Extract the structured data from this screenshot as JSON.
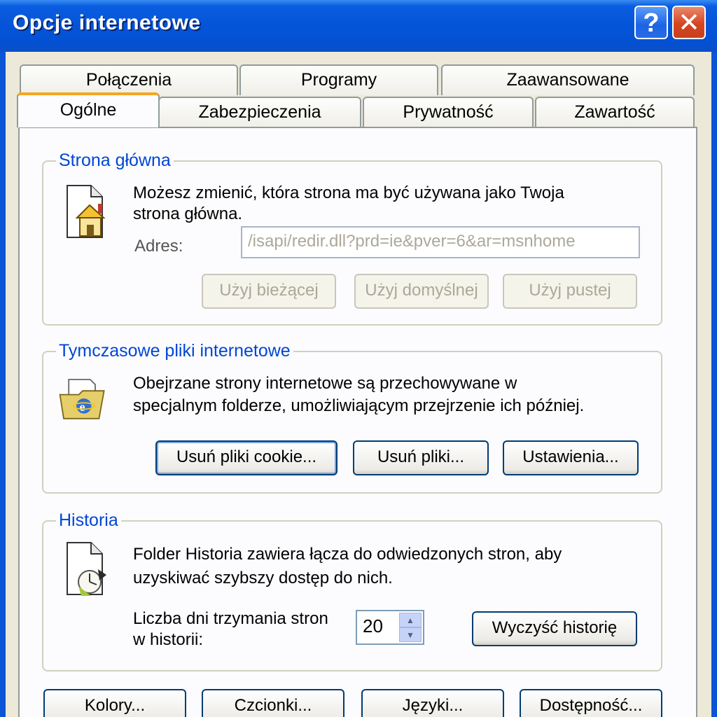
{
  "window": {
    "title": "Opcje internetowe",
    "help_label": "?",
    "close_label": "✕"
  },
  "tabs": {
    "row_back": [
      "Połączenia",
      "Programy",
      "Zaawansowane"
    ],
    "row_front": [
      "Ogólne",
      "Zabezpieczenia",
      "Prywatność",
      "Zawartość"
    ],
    "active": "Ogólne"
  },
  "home": {
    "legend": "Strona główna",
    "desc_line1": "Możesz zmienić, która strona ma być używana jako Twoja",
    "desc_line2": "strona główna.",
    "address_label": "Adres:",
    "address_value": "/isapi/redir.dll?prd=ie&pver=6&ar=msnhome",
    "btn_current": "Użyj bieżącej",
    "btn_default": "Użyj domyślnej",
    "btn_blank": "Użyj pustej",
    "icon": "home-page-icon"
  },
  "temp": {
    "legend": "Tymczasowe pliki internetowe",
    "desc_line1": "Obejrzane strony internetowe są przechowywane w",
    "desc_line2": "specjalnym folderze, umożliwiającym przejrzenie ich później.",
    "btn_cookies": "Usuń pliki cookie...",
    "btn_files": "Usuń pliki...",
    "btn_settings": "Ustawienia...",
    "icon": "temp-files-folder-icon"
  },
  "history": {
    "legend": "Historia",
    "desc_line1": "Folder Historia zawiera łącza do odwiedzonych stron, aby",
    "desc_line2": "uzyskiwać szybszy dostęp do nich.",
    "days_label_line1": "Liczba dni trzymania stron",
    "days_label_line2": "w historii:",
    "days_value": "20",
    "btn_clear": "Wyczyść historię",
    "icon": "history-clock-icon"
  },
  "bottom": {
    "btn_colors": "Kolory...",
    "btn_fonts": "Czcionki...",
    "btn_languages": "Języki...",
    "btn_accessibility": "Dostępność..."
  },
  "colors": {
    "titlebar": "#0554d8",
    "legend": "#0046d5",
    "active_tab_accent": "#f5a623"
  }
}
